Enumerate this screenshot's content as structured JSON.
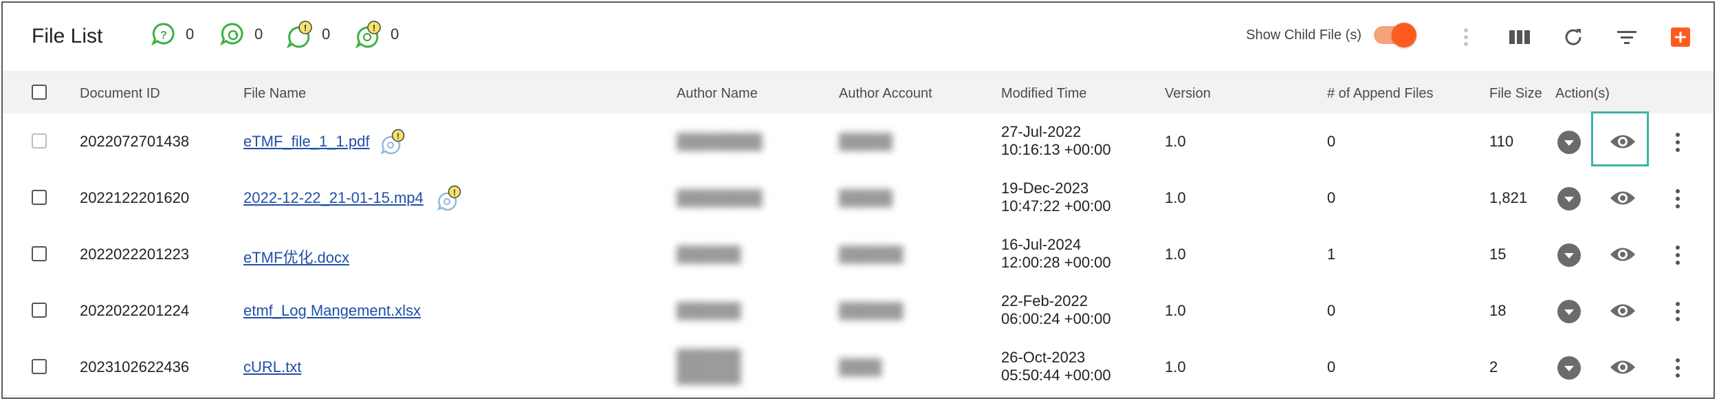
{
  "toolbar": {
    "title": "File List",
    "counters": [
      {
        "icon": "question-bubble-icon",
        "value": "0"
      },
      {
        "icon": "sync-bubble-icon",
        "value": "0"
      },
      {
        "icon": "warning-bubble-icon",
        "value": "0"
      },
      {
        "icon": "warning-sync-bubble-icon",
        "value": "0"
      }
    ],
    "show_child_label": "Show Child File (s)",
    "show_child_on": true
  },
  "table": {
    "headers": {
      "doc_id": "Document ID",
      "file_name": "File Name",
      "author_name": "Author Name",
      "author_account": "Author Account",
      "modified": "Modified Time",
      "version": "Version",
      "append": "# of Append Files",
      "size": "File Size",
      "actions": "Action(s)"
    },
    "rows": [
      {
        "doc_id": "2022072701438",
        "file_name": "eTMF_file_1_1.pdf",
        "author_name": "",
        "author_account": "",
        "date": "27-Jul-2022",
        "time": "10:16:13 +00:00",
        "version": "1.0",
        "append": "0",
        "size": "110"
      },
      {
        "doc_id": "2022122201620",
        "file_name": "2022-12-22_21-01-15.mp4",
        "author_name": "",
        "author_account": "",
        "date": "19-Dec-2023",
        "time": "10:47:22 +00:00",
        "version": "1.0",
        "append": "0",
        "size": "1,821"
      },
      {
        "doc_id": "2022022201223",
        "file_name": "eTMF优化.docx",
        "author_name": "",
        "author_account": "",
        "date": "16-Jul-2024",
        "time": "12:00:28 +00:00",
        "version": "1.0",
        "append": "1",
        "size": "15"
      },
      {
        "doc_id": "2022022201224",
        "file_name": "etmf_Log Mangement.xlsx",
        "author_name": "",
        "author_account": "",
        "date": "22-Feb-2022",
        "time": "06:00:24 +00:00",
        "version": "1.0",
        "append": "0",
        "size": "18"
      },
      {
        "doc_id": "2023102622436",
        "file_name": "cURL.txt",
        "author_name": "",
        "author_account": "",
        "date": "26-Oct-2023",
        "time": "05:50:44 +00:00",
        "version": "1.0",
        "append": "0",
        "size": "2"
      }
    ]
  },
  "colors": {
    "accent": "#ff5b1f",
    "link": "#1f4fa8",
    "status_green": "#3cb043",
    "focus_ring": "#3bb3a4"
  }
}
